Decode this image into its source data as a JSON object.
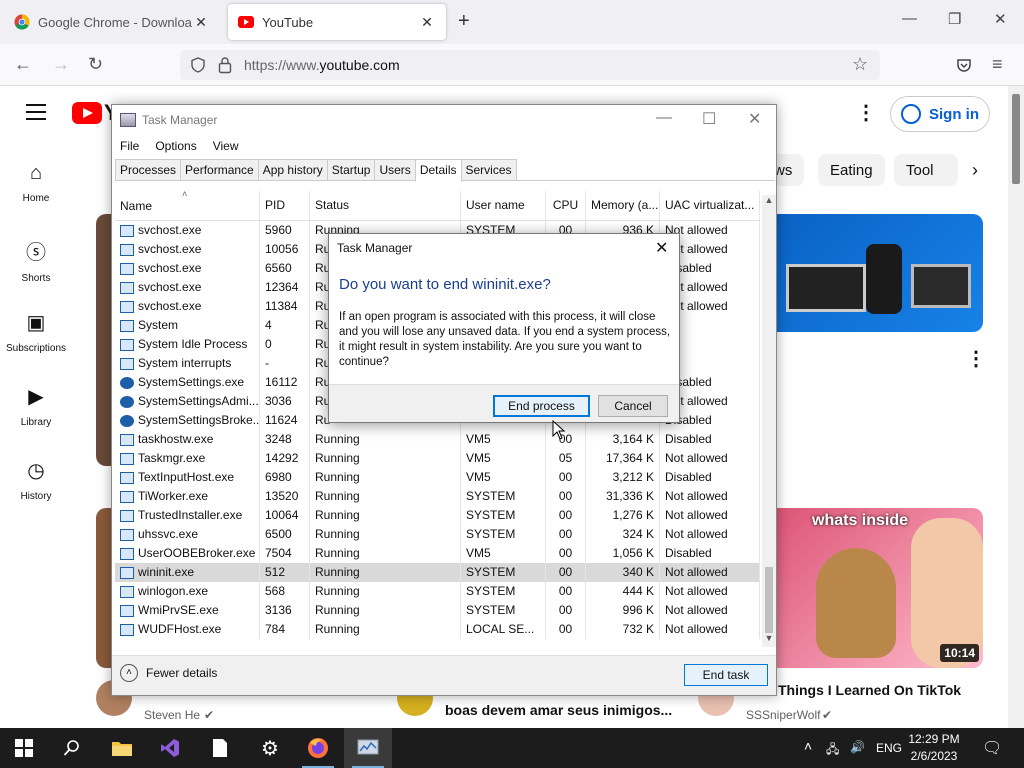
{
  "browser": {
    "tabs": [
      {
        "title": "Google Chrome - Download th",
        "active": false
      },
      {
        "title": "YouTube",
        "active": true
      }
    ],
    "url_prefix": "https://www.",
    "url_host": "youtube.com",
    "new_tab_glyph": "+",
    "close_glyph": "✕"
  },
  "youtube": {
    "logo_text": "Y",
    "sign_in": "Sign in",
    "sidebar": [
      {
        "label": "Home",
        "icon": "home-icon"
      },
      {
        "label": "Shorts",
        "icon": "shorts-icon"
      },
      {
        "label": "Subscriptions",
        "icon": "subscriptions-icon"
      },
      {
        "label": "Library",
        "icon": "library-icon"
      },
      {
        "label": "History",
        "icon": "history-icon"
      }
    ],
    "chips": [
      "ws",
      "Eating",
      "Tool"
    ],
    "cards": {
      "card2_caption": "whats inside",
      "card2_duration": "10:14"
    },
    "videos": [
      {
        "title": "Things I Learned On TikTok",
        "channel": "SSSniperWolf"
      },
      {
        "title": "boas devem amar seus inimigos...",
        "channel": ""
      },
      {
        "title": "",
        "channel": "Steven He"
      }
    ]
  },
  "taskmanager": {
    "title": "Task Manager",
    "menu": [
      "File",
      "Options",
      "View"
    ],
    "tabs": [
      "Processes",
      "Performance",
      "App history",
      "Startup",
      "Users",
      "Details",
      "Services"
    ],
    "selected_tab": "Details",
    "columns": [
      "Name",
      "PID",
      "Status",
      "User name",
      "CPU",
      "Memory (a...",
      "UAC virtualizat..."
    ],
    "rows": [
      {
        "name": "svchost.exe",
        "pid": "5960",
        "status": "Running",
        "user": "SYSTEM",
        "cpu": "00",
        "mem": "936 K",
        "uac": "Not allowed",
        "icon": "window"
      },
      {
        "name": "svchost.exe",
        "pid": "10056",
        "status": "Ru",
        "user": "",
        "cpu": "",
        "mem": "",
        "uac": "Not allowed",
        "icon": "window"
      },
      {
        "name": "svchost.exe",
        "pid": "6560",
        "status": "Ru",
        "user": "",
        "cpu": "",
        "mem": "",
        "uac": "Disabled",
        "icon": "window"
      },
      {
        "name": "svchost.exe",
        "pid": "12364",
        "status": "Ru",
        "user": "",
        "cpu": "",
        "mem": "",
        "uac": "Not allowed",
        "icon": "window"
      },
      {
        "name": "svchost.exe",
        "pid": "11384",
        "status": "Ru",
        "user": "",
        "cpu": "",
        "mem": "",
        "uac": "Not allowed",
        "icon": "window"
      },
      {
        "name": "System",
        "pid": "4",
        "status": "Ru",
        "user": "",
        "cpu": "",
        "mem": "",
        "uac": "",
        "icon": "window"
      },
      {
        "name": "System Idle Process",
        "pid": "0",
        "status": "Ru",
        "user": "",
        "cpu": "",
        "mem": "",
        "uac": "",
        "icon": "window"
      },
      {
        "name": "System interrupts",
        "pid": "-",
        "status": "Ru",
        "user": "",
        "cpu": "",
        "mem": "",
        "uac": "",
        "icon": "window"
      },
      {
        "name": "SystemSettings.exe",
        "pid": "16112",
        "status": "Ru",
        "user": "",
        "cpu": "",
        "mem": "",
        "uac": "Disabled",
        "icon": "gear"
      },
      {
        "name": "SystemSettingsAdmi...",
        "pid": "3036",
        "status": "Ru",
        "user": "",
        "cpu": "",
        "mem": "",
        "uac": "Not allowed",
        "icon": "gear"
      },
      {
        "name": "SystemSettingsBroke...",
        "pid": "11624",
        "status": "Ru",
        "user": "",
        "cpu": "",
        "mem": "",
        "uac": "Disabled",
        "icon": "gear"
      },
      {
        "name": "taskhostw.exe",
        "pid": "3248",
        "status": "Running",
        "user": "VM5",
        "cpu": "00",
        "mem": "3,164 K",
        "uac": "Disabled",
        "icon": "window"
      },
      {
        "name": "Taskmgr.exe",
        "pid": "14292",
        "status": "Running",
        "user": "VM5",
        "cpu": "05",
        "mem": "17,364 K",
        "uac": "Not allowed",
        "icon": "window"
      },
      {
        "name": "TextInputHost.exe",
        "pid": "6980",
        "status": "Running",
        "user": "VM5",
        "cpu": "00",
        "mem": "3,212 K",
        "uac": "Disabled",
        "icon": "window"
      },
      {
        "name": "TiWorker.exe",
        "pid": "13520",
        "status": "Running",
        "user": "SYSTEM",
        "cpu": "00",
        "mem": "31,336 K",
        "uac": "Not allowed",
        "icon": "window"
      },
      {
        "name": "TrustedInstaller.exe",
        "pid": "10064",
        "status": "Running",
        "user": "SYSTEM",
        "cpu": "00",
        "mem": "1,276 K",
        "uac": "Not allowed",
        "icon": "window"
      },
      {
        "name": "uhssvc.exe",
        "pid": "6500",
        "status": "Running",
        "user": "SYSTEM",
        "cpu": "00",
        "mem": "324 K",
        "uac": "Not allowed",
        "icon": "window"
      },
      {
        "name": "UserOOBEBroker.exe",
        "pid": "7504",
        "status": "Running",
        "user": "VM5",
        "cpu": "00",
        "mem": "1,056 K",
        "uac": "Disabled",
        "icon": "window"
      },
      {
        "name": "wininit.exe",
        "pid": "512",
        "status": "Running",
        "user": "SYSTEM",
        "cpu": "00",
        "mem": "340 K",
        "uac": "Not allowed",
        "icon": "window",
        "selected": true
      },
      {
        "name": "winlogon.exe",
        "pid": "568",
        "status": "Running",
        "user": "SYSTEM",
        "cpu": "00",
        "mem": "444 K",
        "uac": "Not allowed",
        "icon": "window"
      },
      {
        "name": "WmiPrvSE.exe",
        "pid": "3136",
        "status": "Running",
        "user": "SYSTEM",
        "cpu": "00",
        "mem": "996 K",
        "uac": "Not allowed",
        "icon": "window"
      },
      {
        "name": "WUDFHost.exe",
        "pid": "784",
        "status": "Running",
        "user": "LOCAL SE...",
        "cpu": "00",
        "mem": "732 K",
        "uac": "Not allowed",
        "icon": "window"
      }
    ],
    "fewer_details": "Fewer details",
    "end_task": "End task"
  },
  "dialog": {
    "title": "Task Manager",
    "question": "Do you want to end wininit.exe?",
    "message": "If an open program is associated with this process, it will close and you will lose any unsaved data. If you end a system process, it might result in system instability. Are you sure you want to continue?",
    "primary": "End process",
    "secondary": "Cancel"
  },
  "taskbar": {
    "language": "ENG",
    "time": "12:29 PM",
    "date": "2/6/2023"
  },
  "colors": {
    "youtube_red": "#ff0000",
    "sign_in_blue": "#065fd4",
    "dialog_heading": "#1a3f8f",
    "focus_blue": "#0078d7"
  }
}
